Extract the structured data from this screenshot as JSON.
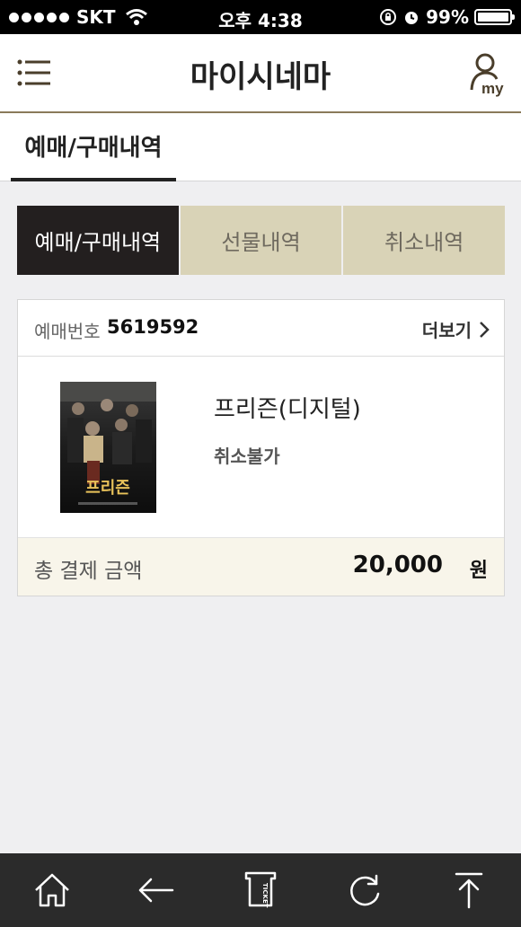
{
  "status_bar": {
    "carrier": "SKT",
    "time": "오후 4:38",
    "battery": "99%",
    "battery_level": 0.99
  },
  "header": {
    "title": "마이시네마",
    "menu_icon": "hamburger-menu-icon",
    "my_icon": "my-account-icon",
    "my_label": "my"
  },
  "subnav": {
    "active_tab": "예매/구매내역"
  },
  "tabs": [
    {
      "label": "예매/구매내역",
      "active": true
    },
    {
      "label": "선물내역",
      "active": false
    },
    {
      "label": "취소내역",
      "active": false
    }
  ],
  "booking": {
    "number_label": "예매번호",
    "number": "5619592",
    "more_label": "더보기",
    "movie_title": "프리즌(디지털)",
    "status": "취소불가",
    "poster_title": "프리즌",
    "total_label": "총 결제 금액",
    "total_amount": "20,000",
    "currency": "원"
  },
  "bottom_bar": {
    "items": [
      {
        "icon": "home-icon"
      },
      {
        "icon": "back-arrow-icon"
      },
      {
        "icon": "ticket-icon",
        "label": "TICKET"
      },
      {
        "icon": "refresh-icon"
      },
      {
        "icon": "scroll-top-icon"
      }
    ]
  },
  "colors": {
    "accent_dark": "#231f1f",
    "tab_beige": "#d9d3b7",
    "total_bg": "#f8f5ea",
    "header_line": "#8a7a5a"
  }
}
